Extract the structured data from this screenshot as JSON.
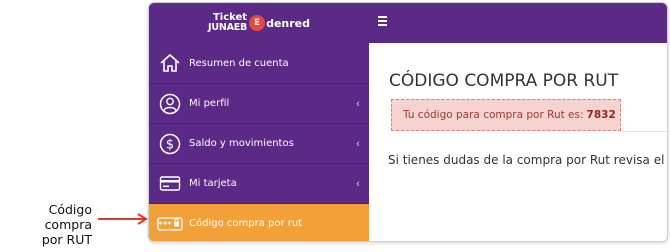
{
  "callout": {
    "line1": "Código compra",
    "line2": "por RUT"
  },
  "brand": {
    "line1": "Ticket",
    "line2": "JUNAEB",
    "logo_letter": "E",
    "logo_text": "denred"
  },
  "sidebar": {
    "items": [
      {
        "label": "Resumen de cuenta",
        "icon": "home-icon",
        "chevron": ""
      },
      {
        "label": "Mi perfil",
        "icon": "user-icon",
        "chevron": "‹"
      },
      {
        "label": "Saldo y movimientos",
        "icon": "dollar-icon",
        "chevron": "‹"
      },
      {
        "label": "Mi tarjeta",
        "icon": "card-icon",
        "chevron": "‹"
      },
      {
        "label": "Código compra por rut",
        "icon": "password-icon",
        "chevron": ""
      }
    ],
    "active_index": 4
  },
  "main": {
    "title": "CÓDIGO COMPRA POR RUT",
    "alert_text": "Tu código para compra por Rut es:",
    "alert_code": "7832",
    "help_text": "Si tienes dudas de la compra por Rut revisa el"
  },
  "colors": {
    "purple": "#5b2a86",
    "orange": "#f2a039",
    "alert_bg": "#f6d3d0",
    "arrow": "#e2352b"
  }
}
